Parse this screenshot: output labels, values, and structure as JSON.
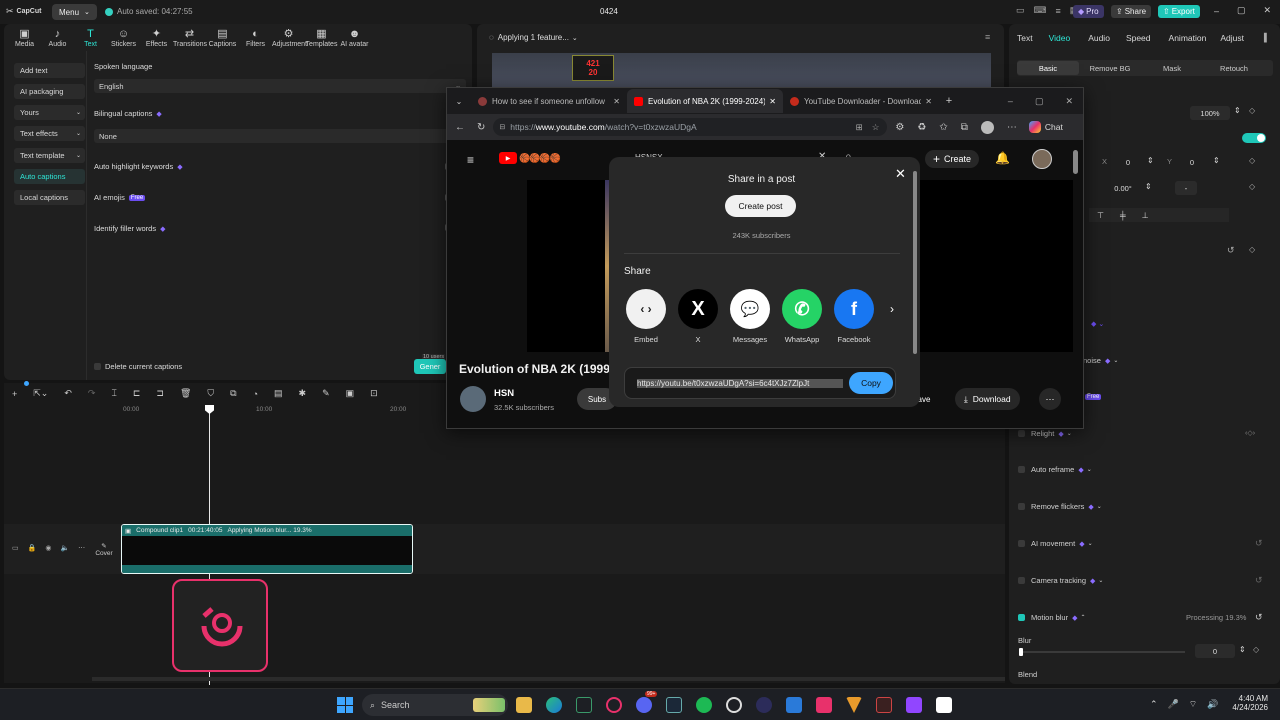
{
  "app": {
    "logo": "CapCut",
    "menu_label": "Menu",
    "autosave": "Auto saved: 04:27:55",
    "project_title": "0424",
    "pro_label": "Pro",
    "share_label": "Share",
    "export_label": "Export"
  },
  "tools": [
    {
      "label": "Media",
      "icon": "media-icon"
    },
    {
      "label": "Audio",
      "icon": "audio-icon"
    },
    {
      "label": "Text",
      "icon": "text-icon"
    },
    {
      "label": "Stickers",
      "icon": "stickers-icon"
    },
    {
      "label": "Effects",
      "icon": "effects-icon"
    },
    {
      "label": "Transitions",
      "icon": "transitions-icon"
    },
    {
      "label": "Captions",
      "icon": "captions-icon"
    },
    {
      "label": "Filters",
      "icon": "filters-icon"
    },
    {
      "label": "Adjustment",
      "icon": "adjustment-icon"
    },
    {
      "label": "Templates",
      "icon": "templates-icon"
    },
    {
      "label": "AI avatar",
      "icon": "ai-avatar-icon"
    }
  ],
  "left_nav": [
    "Add text",
    "AI packaging",
    "Yours",
    "Text effects",
    "Text template",
    "Auto captions",
    "Local captions"
  ],
  "captions_panel": {
    "spoken_language_label": "Spoken language",
    "spoken_language_value": "English",
    "bilingual_label": "Bilingual captions",
    "bilingual_value": "None",
    "highlight_label": "Auto highlight keywords",
    "emojis_label": "AI emojis",
    "free_badge": "Free",
    "filler_label": "Identify filler words",
    "delete_label": "Delete current captions",
    "users_badge": "10 users",
    "generate_label": "Gener"
  },
  "preview": {
    "status": "Applying 1 feature...",
    "scoreboard": [
      "421",
      "20"
    ]
  },
  "right_panel": {
    "tabs": [
      "Text",
      "Video",
      "Audio",
      "Speed",
      "Animation",
      "Adjust"
    ],
    "subtabs": [
      "Basic",
      "Remove BG",
      "Mask",
      "Retouch"
    ],
    "scale_value": "100%",
    "pos_x_label": "X",
    "pos_x_value": "0",
    "pos_y_label": "Y",
    "pos_y_value": "0",
    "rotate_value": "0.00°",
    "rotate_dash": "-",
    "noise_label": "noise",
    "free_badge": "Free",
    "features": [
      {
        "label": "Relight"
      },
      {
        "label": "Auto reframe"
      },
      {
        "label": "Remove flickers"
      },
      {
        "label": "AI movement"
      },
      {
        "label": "Camera tracking"
      },
      {
        "label": "Motion blur"
      }
    ],
    "processing": "Processing 19.3%",
    "blur_label": "Blur",
    "blur_value": "0",
    "blend_label": "Blend"
  },
  "timeline": {
    "ticks": [
      "00:00",
      "10:00",
      "20:00"
    ],
    "clip_name": "Compound clip1",
    "clip_duration": "00:21:40:05",
    "clip_status": "Applying Motion blur... 19.3%",
    "cover_label": "Cover"
  },
  "browser": {
    "tabs": [
      {
        "label": "How to see if someone unfollow"
      },
      {
        "label": "Evolution of NBA 2K (1999-2024)"
      },
      {
        "label": "YouTube Downloader - Download"
      }
    ],
    "url_prefix": "https://",
    "url_host": "www.youtube.com",
    "url_path": "/watch?v=t0xzwzaUDgA",
    "chat_label": "Chat",
    "search_text": "HSNSX",
    "create_label": "Create",
    "video_title": "Evolution of NBA 2K (1999",
    "channel_name": "HSN",
    "channel_subs": "32.5K subscribers",
    "subscribe_label": "Subs",
    "save_label": "ave",
    "download_label": "Download"
  },
  "share_dialog": {
    "title": "Share in a post",
    "create_post": "Create post",
    "subscribers": "243K subscribers",
    "share_heading": "Share",
    "targets": [
      {
        "label": "Embed",
        "color": "#f1f1f1",
        "glyph": "‹ ›"
      },
      {
        "label": "X",
        "color": "#000000",
        "glyph": "X"
      },
      {
        "label": "Messages",
        "color": "#ffffff",
        "glyph": "💬"
      },
      {
        "label": "WhatsApp",
        "color": "#25d366",
        "glyph": "✆"
      },
      {
        "label": "Facebook",
        "color": "#1877f2",
        "glyph": "f"
      }
    ],
    "link": "https://youtu.be/t0xzwzaUDgA?si=6c4tXJz7ZlpJt",
    "copy_label": "Copy"
  },
  "taskbar": {
    "search_label": "Search",
    "badge": "99+",
    "time": "4:40 AM",
    "date": "4/24/2026"
  },
  "colors": {
    "accent": "#2ee6d6",
    "youtube_red": "#ff0000",
    "copy_blue": "#3ea6ff",
    "capcut_clip": "#1a6e6a"
  }
}
